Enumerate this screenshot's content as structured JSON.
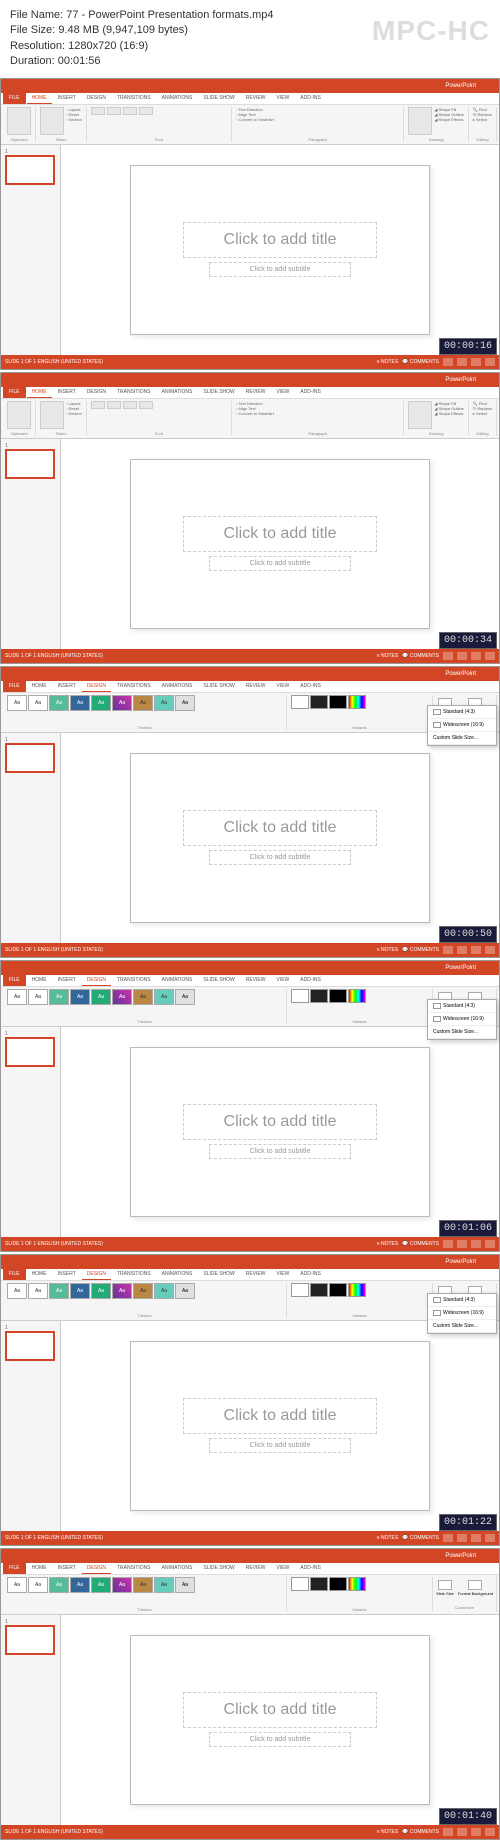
{
  "header": {
    "file_name_label": "File Name:",
    "file_name": "77 - PowerPoint Presentation formats.mp4",
    "file_size_label": "File Size:",
    "file_size": "9.48 MB (9,947,109 bytes)",
    "resolution_label": "Resolution:",
    "resolution": "1280x720 (16:9)",
    "duration_label": "Duration:",
    "duration": "00:01:56",
    "logo": "MPC-HC"
  },
  "tabs": {
    "file": "FILE",
    "home": "HOME",
    "insert": "INSERT",
    "design": "DESIGN",
    "transitions": "TRANSITIONS",
    "animations": "ANIMATIONS",
    "slideshow": "SLIDE SHOW",
    "review": "REVIEW",
    "view": "VIEW",
    "addins": "ADD-INS"
  },
  "ribbon": {
    "clipboard": "Clipboard",
    "slides": "Slides",
    "font": "Font",
    "paragraph": "Paragraph",
    "drawing": "Drawing",
    "editing": "Editing",
    "paste": "Paste",
    "new_slide": "New Slide",
    "layout": "Layout",
    "reset": "Reset",
    "section": "Section",
    "themes": "Themes",
    "variants": "Variants",
    "customize": "Customize",
    "text_direction": "Text Direction",
    "align_text": "Align Text",
    "convert_smartart": "Convert to SmartArt",
    "shape_fill": "Shape Fill",
    "shape_outline": "Shape Outline",
    "shape_effects": "Shape Effects",
    "find": "Find",
    "replace": "Replace",
    "select": "Select",
    "slide_size": "Slide Size",
    "format_bg": "Format Background"
  },
  "slide": {
    "title": "Click to add title",
    "subtitle": "Click to add subtitle"
  },
  "status": {
    "left": "SLIDE 1 OF 1    ENGLISH (UNITED STATES)",
    "notes": "NOTES",
    "comments": "COMMENTS"
  },
  "dropdown": {
    "standard": "Standard (4:3)",
    "widescreen": "Widescreen (16:9)",
    "custom": "Custom Slide Size..."
  },
  "theme_label": "Aa",
  "timestamps": [
    "00:00:16",
    "00:00:34",
    "00:00:50",
    "00:01:06",
    "00:01:22",
    "00:01:40"
  ],
  "window_title": "PowerPoint"
}
